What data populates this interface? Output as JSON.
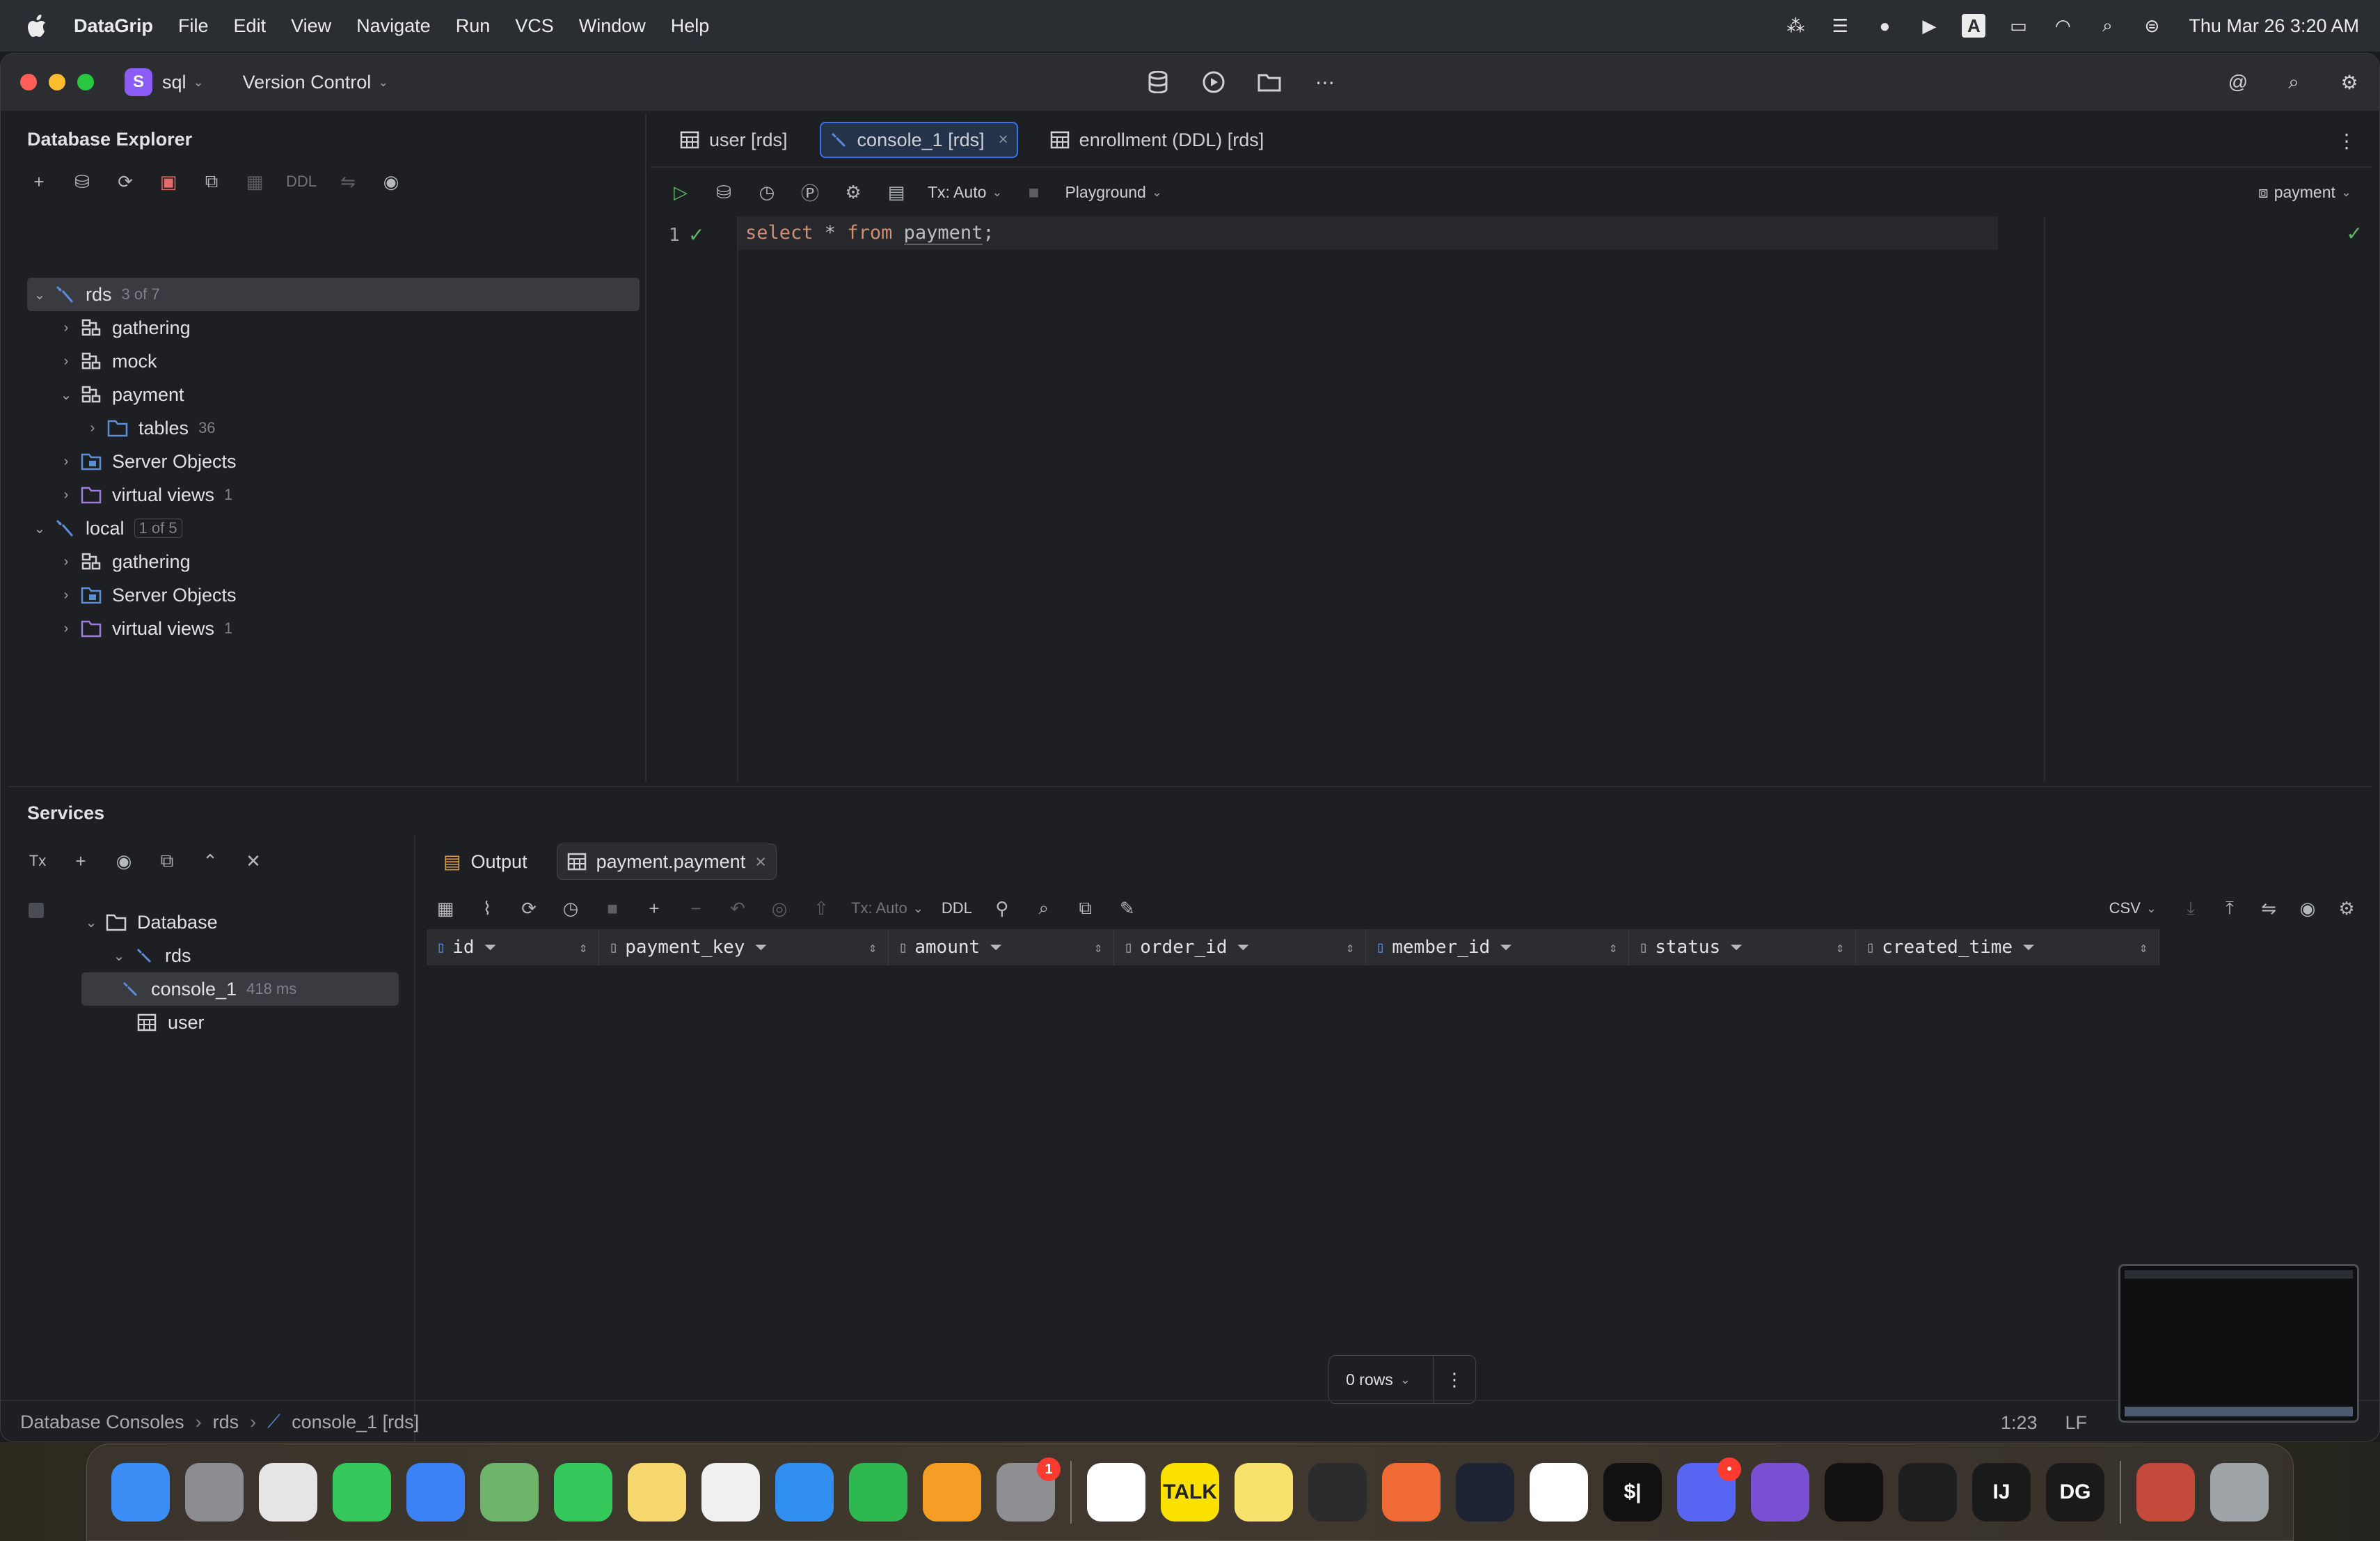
{
  "menubar": {
    "app_name": "DataGrip",
    "items": [
      "File",
      "Edit",
      "View",
      "Navigate",
      "Run",
      "VCS",
      "Window",
      "Help"
    ],
    "clock": "Thu Mar 26  3:20 AM",
    "status_icons": [
      "figma-icon",
      "list-icon",
      "messenger-icon",
      "play-icon",
      "keyboard-a-icon",
      "battery-icon",
      "wifi-icon",
      "search-icon",
      "control-center-icon"
    ]
  },
  "titlebar": {
    "project_badge": "S",
    "project_name": "sql",
    "vcs_label": "Version Control"
  },
  "explorer": {
    "title": "Database Explorer",
    "ddl_label": "DDL",
    "tree": [
      {
        "label": "rds",
        "count": "3 of 7",
        "kind": "datasource",
        "level": 0,
        "expanded": true,
        "selected": true
      },
      {
        "label": "gathering",
        "count": "",
        "kind": "schema",
        "level": 1,
        "expanded": false
      },
      {
        "label": "mock",
        "count": "",
        "kind": "schema",
        "level": 1,
        "expanded": false
      },
      {
        "label": "payment",
        "count": "",
        "kind": "schema",
        "level": 1,
        "expanded": true
      },
      {
        "label": "tables",
        "count": "36",
        "kind": "folder",
        "level": 2,
        "expanded": false
      },
      {
        "label": "Server Objects",
        "count": "",
        "kind": "server",
        "level": 1,
        "expanded": false
      },
      {
        "label": "virtual views",
        "count": "1",
        "kind": "vfolder",
        "level": 1,
        "expanded": false
      },
      {
        "label": "local",
        "count": "1 of 5",
        "kind": "datasource",
        "level": 0,
        "expanded": true,
        "boxed": true
      },
      {
        "label": "gathering",
        "count": "",
        "kind": "schema",
        "level": 1,
        "expanded": false
      },
      {
        "label": "Server Objects",
        "count": "",
        "kind": "server",
        "level": 1,
        "expanded": false
      },
      {
        "label": "virtual views",
        "count": "1",
        "kind": "vfolder",
        "level": 1,
        "expanded": false
      }
    ]
  },
  "editor": {
    "tabs": [
      {
        "label": "user [rds]",
        "active": false
      },
      {
        "label": "console_1 [rds]",
        "active": true
      },
      {
        "label": "enrollment (DDL) [rds]",
        "active": false
      }
    ],
    "tx_label": "Tx: Auto",
    "playground_label": "Playground",
    "schema_label": "payment",
    "line_number": "1",
    "code": {
      "kw1": "select",
      "star": " * ",
      "kw2": "from",
      "table": "payment",
      "semi": ";"
    }
  },
  "services": {
    "title": "Services",
    "tx_icon_label": "Tx",
    "tree": [
      {
        "label": "Database",
        "extra": "",
        "level": 0
      },
      {
        "label": "rds",
        "extra": "",
        "level": 1
      },
      {
        "label": "console_1",
        "extra": "418 ms",
        "level": 2,
        "selected": true
      },
      {
        "label": "user",
        "extra": "",
        "level": 2
      }
    ],
    "result_tabs": [
      {
        "label": "Output",
        "active": false
      },
      {
        "label": "payment.payment",
        "active": true
      }
    ],
    "grid_tx_label": "Tx: Auto",
    "grid_ddl_label": "DDL",
    "export_format": "CSV",
    "columns": [
      "id",
      "payment_key",
      "amount",
      "order_id",
      "member_id",
      "status",
      "created_time"
    ],
    "rows_label": "0 rows"
  },
  "statusbar": {
    "breadcrumbs": [
      "Database Consoles",
      "rds",
      "console_1 [rds]"
    ],
    "position": "1:23",
    "line_ending": "LF"
  },
  "dock": {
    "apps": [
      {
        "name": "finder-icon",
        "color": "#3b8ef5",
        "label": ""
      },
      {
        "name": "launchpad-icon",
        "color": "#8c8c93",
        "label": ""
      },
      {
        "name": "chrome-icon",
        "color": "#e5e5e5",
        "label": ""
      },
      {
        "name": "messages-icon",
        "color": "#34c759",
        "label": ""
      },
      {
        "name": "mail-icon",
        "color": "#3b82f6",
        "label": ""
      },
      {
        "name": "maps-icon",
        "color": "#6fb46b",
        "label": ""
      },
      {
        "name": "facetime-icon",
        "color": "#34c759",
        "label": ""
      },
      {
        "name": "notes-icon",
        "color": "#f5d76e",
        "label": ""
      },
      {
        "name": "freeform-icon",
        "color": "#f0f0f0",
        "label": ""
      },
      {
        "name": "keynote-icon",
        "color": "#2f8ef0",
        "label": ""
      },
      {
        "name": "numbers-icon",
        "color": "#2fb84f",
        "label": ""
      },
      {
        "name": "pages-icon",
        "color": "#f59d24",
        "label": ""
      },
      {
        "name": "settings-icon",
        "color": "#8e8e93",
        "label": "",
        "badge": "1"
      },
      {
        "sep": true
      },
      {
        "name": "slack-icon",
        "color": "#ffffff",
        "label": ""
      },
      {
        "name": "kakaotalk-icon",
        "color": "#fae100",
        "label": "TALK"
      },
      {
        "name": "stickies-icon",
        "color": "#f8e16c",
        "label": ""
      },
      {
        "name": "activity-monitor-icon",
        "color": "#2c2c2e",
        "label": ""
      },
      {
        "name": "pencil-app-icon",
        "color": "#f06a35",
        "label": ""
      },
      {
        "name": "chatgpt-icon",
        "color": "#1c2333",
        "label": ""
      },
      {
        "name": "vscode-icon",
        "color": "#ffffff",
        "label": ""
      },
      {
        "name": "terminal-icon",
        "color": "#111111",
        "label": "$|"
      },
      {
        "name": "discord-icon",
        "color": "#5865f2",
        "label": "",
        "badge": "•"
      },
      {
        "name": "github-icon",
        "color": "#7b4fd1",
        "label": ""
      },
      {
        "name": "spotify-icon",
        "color": "#111111",
        "label": ""
      },
      {
        "name": "figma-icon",
        "color": "#1e1e1e",
        "label": ""
      },
      {
        "name": "intellij-icon",
        "color": "#1a1a1a",
        "label": "IJ"
      },
      {
        "name": "datagrip-icon",
        "color": "#1a1a1a",
        "label": "DG"
      },
      {
        "sep": true
      },
      {
        "name": "book-icon",
        "color": "#c34a3a",
        "label": ""
      },
      {
        "name": "trash-icon",
        "color": "#9ea3a8",
        "label": ""
      }
    ]
  }
}
